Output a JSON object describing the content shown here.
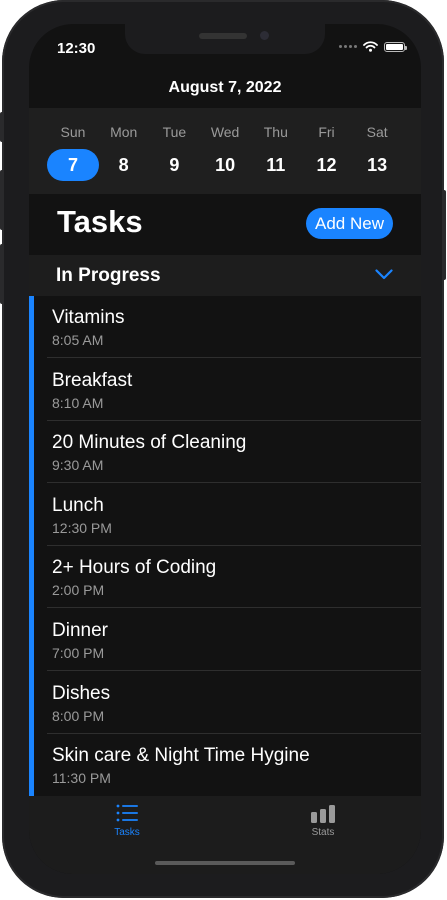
{
  "status": {
    "time": "12:30"
  },
  "header": {
    "date": "August 7, 2022"
  },
  "calendar": {
    "days": [
      {
        "name": "Sun",
        "date": "7"
      },
      {
        "name": "Mon",
        "date": "8"
      },
      {
        "name": "Tue",
        "date": "9"
      },
      {
        "name": "Wed",
        "date": "10"
      },
      {
        "name": "Thu",
        "date": "11"
      },
      {
        "name": "Fri",
        "date": "12"
      },
      {
        "name": "Sat",
        "date": "13"
      }
    ],
    "selected": "7"
  },
  "tasks": {
    "title": "Tasks",
    "add_label": "Add New"
  },
  "section": {
    "title": "In Progress",
    "icon": "chevron-down-icon"
  },
  "items": [
    {
      "name": "Vitamins",
      "time": "8:05 AM"
    },
    {
      "name": "Breakfast",
      "time": "8:10 AM"
    },
    {
      "name": "20 Minutes of Cleaning",
      "time": "9:30 AM"
    },
    {
      "name": "Lunch",
      "time": "12:30 PM"
    },
    {
      "name": "2+ Hours of Coding",
      "time": "2:00 PM"
    },
    {
      "name": "Dinner",
      "time": "7:00 PM"
    },
    {
      "name": "Dishes",
      "time": "8:00 PM"
    },
    {
      "name": "Skin care & Night Time Hygine",
      "time": "11:30 PM"
    }
  ],
  "tabbar": {
    "tabs": [
      {
        "label": "Tasks",
        "icon": "list-icon",
        "active": true
      },
      {
        "label": "Stats",
        "icon": "bar-chart-icon",
        "active": false
      }
    ]
  },
  "colors": {
    "accent": "#1a84ff",
    "background": "#121212",
    "secondary_text": "#9a9a9a"
  }
}
